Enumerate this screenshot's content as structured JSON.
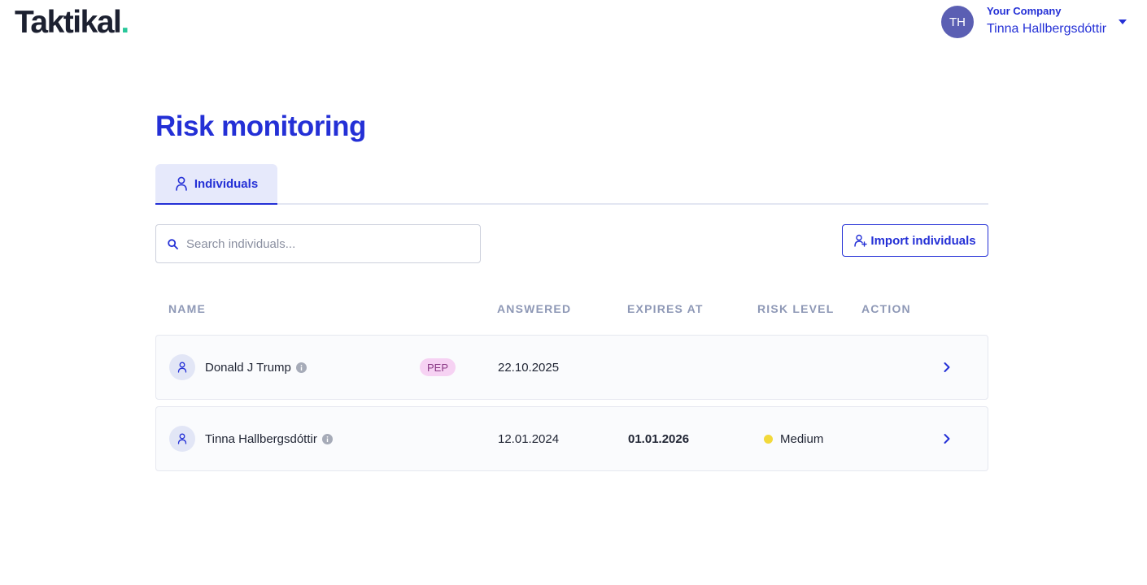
{
  "brand": {
    "name": "Taktikal",
    "dot": "."
  },
  "user": {
    "initials": "TH",
    "company": "Your Company",
    "name": "Tinna Hallbergsdóttir"
  },
  "page": {
    "title": "Risk monitoring"
  },
  "tabs": [
    {
      "label": "Individuals",
      "icon": "person-icon"
    }
  ],
  "search": {
    "placeholder": "Search individuals...",
    "value": ""
  },
  "import_button": {
    "label": "Import individuals",
    "icon": "add-person-icon"
  },
  "table": {
    "columns": [
      "NAME",
      "ANSWERED",
      "EXPIRES AT",
      "RISK LEVEL",
      "ACTION"
    ],
    "rows": [
      {
        "name": "Donald J Trump",
        "badge": "PEP",
        "answered": "22.10.2025",
        "expires_at": "",
        "risk_level": ""
      },
      {
        "name": "Tinna Hallbergsdóttir",
        "badge": "",
        "answered": "12.01.2024",
        "expires_at": "01.01.2026",
        "risk_level": "Medium"
      }
    ]
  },
  "colors": {
    "accent": "#2430d6",
    "avatar": "#5b5fb3",
    "pep_badge_bg": "#f6d2f3",
    "risk_medium": "#f2d93b",
    "logo_dot": "#29c79a"
  }
}
